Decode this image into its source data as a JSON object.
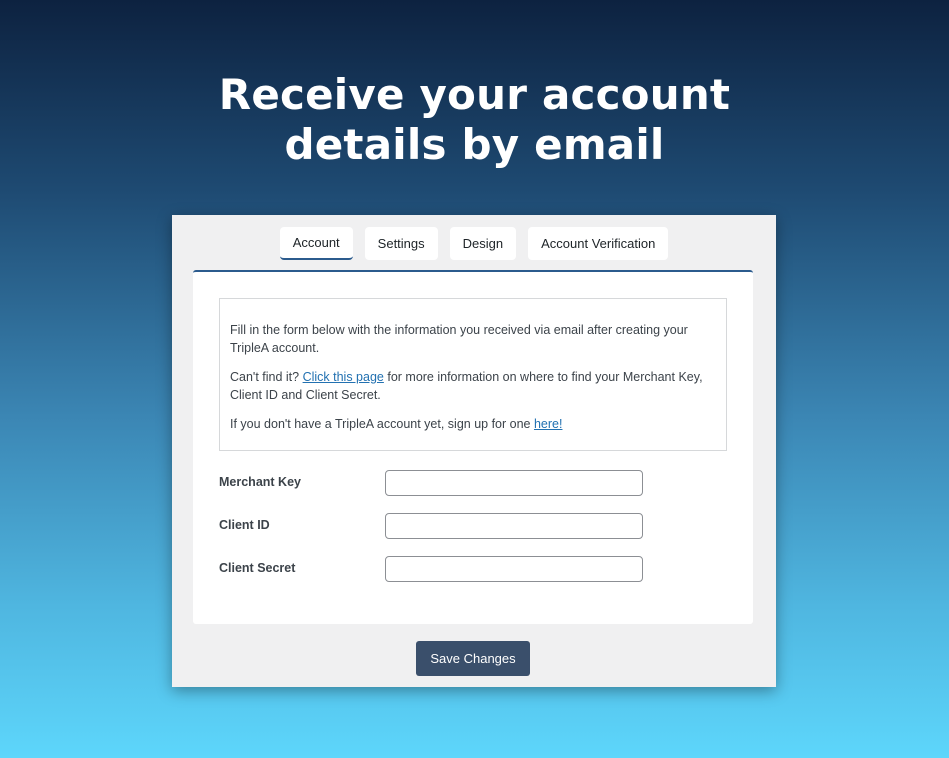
{
  "headline": {
    "line1": "Receive your account",
    "line2": "details by email"
  },
  "tabs": [
    {
      "label": "Account",
      "active": true
    },
    {
      "label": "Settings",
      "active": false
    },
    {
      "label": "Design",
      "active": false
    },
    {
      "label": "Account Verification",
      "active": false
    }
  ],
  "notice": {
    "p1": "Fill in the form below with the information you received via email after creating your TripleA account.",
    "p2_before": "Can't find it? ",
    "p2_link": "Click this page",
    "p2_after": " for more information on where to find your Merchant Key, Client ID and Client Secret.",
    "p3_before": "If you don't have a TripleA account yet, sign up for one ",
    "p3_link": "here!"
  },
  "fields": {
    "merchant_key": {
      "label": "Merchant Key",
      "value": ""
    },
    "client_id": {
      "label": "Client ID",
      "value": ""
    },
    "client_secret": {
      "label": "Client Secret",
      "value": ""
    }
  },
  "save_label": "Save Changes",
  "colors": {
    "accent": "#2b5b8d",
    "link": "#2271b1",
    "button": "#3a4f6b"
  }
}
